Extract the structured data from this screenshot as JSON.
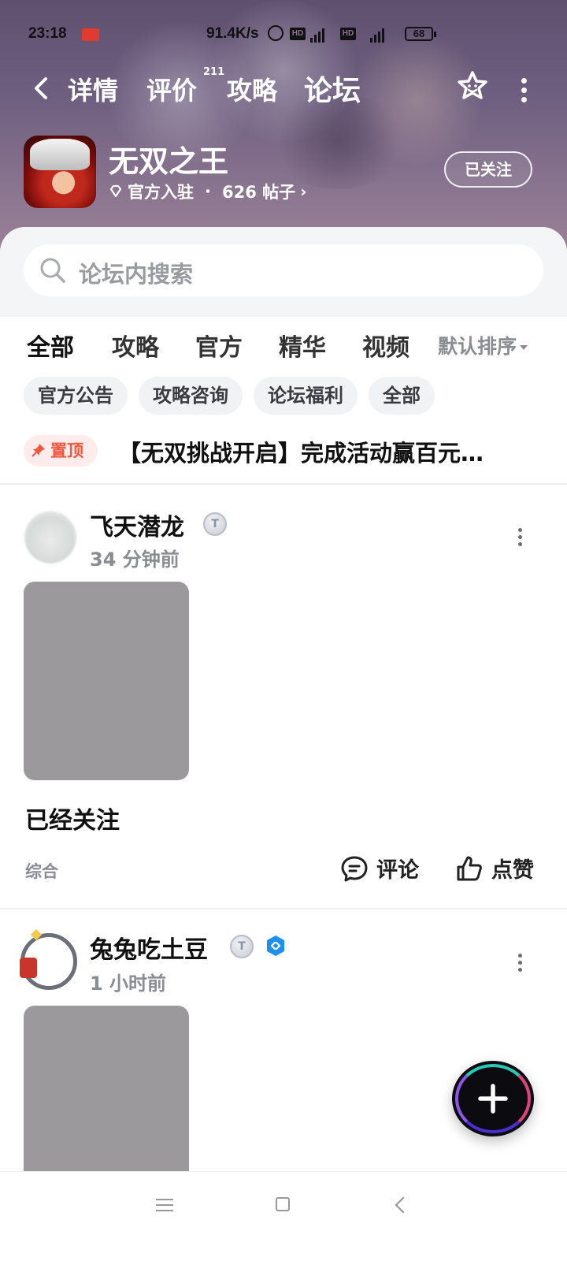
{
  "status_bar": {
    "time": "23:18",
    "net_speed": "91.4K/s",
    "hd1": "HD",
    "net1": "4G",
    "hd2": "HD",
    "net2": "4G",
    "battery": "68"
  },
  "topnav": {
    "tabs": [
      {
        "label": "详情"
      },
      {
        "label": "评价"
      },
      {
        "label": "攻略"
      },
      {
        "label": "论坛"
      }
    ],
    "review_count": "211",
    "active_tab": "论坛",
    "accent_color": "#17d4bf"
  },
  "game": {
    "title": "无双之王",
    "official_label": "官方入驻",
    "separator": "·",
    "posts_label": "626 帖子",
    "follow_label": "已关注"
  },
  "search": {
    "placeholder": "论坛内搜索"
  },
  "filter_tabs": [
    "全部",
    "攻略",
    "官方",
    "精华",
    "视频"
  ],
  "sort_label": "默认排序",
  "chips": [
    "官方公告",
    "攻略咨询",
    "论坛福利",
    "全部"
  ],
  "pinned": {
    "badge": "置顶",
    "title": "【无双挑战开启】完成活动赢百元…"
  },
  "posts": [
    {
      "author": "飞天潜龙",
      "level": "T",
      "time": "34 分钟前",
      "text": "已经关注",
      "category": "综合",
      "comment_label": "评论",
      "like_label": "点赞"
    },
    {
      "author": "兔兔吃土豆",
      "level": "T",
      "time": "1 小时前"
    }
  ]
}
